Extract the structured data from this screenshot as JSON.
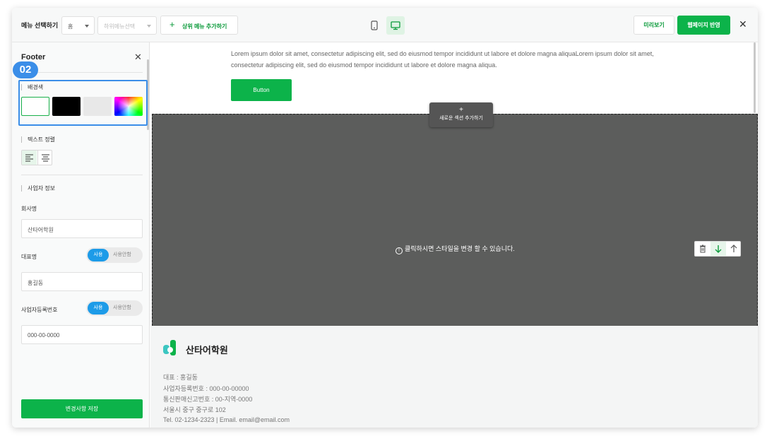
{
  "topbar": {
    "menu_select_label": "메뉴 선택하기",
    "menu_value": "홈",
    "submenu_placeholder": "하위메뉴선택",
    "add_top_menu": "상위 메뉴 추가하기",
    "preview": "미리보기",
    "apply": "웹페이지 반영"
  },
  "sidebar": {
    "title": "Footer",
    "step_badge": "02",
    "bg_color_label": "배경색",
    "bg_colors": [
      "#ffffff",
      "#000000",
      "#e8e8e8"
    ],
    "text_align_label": "텍스트 정렬",
    "business_info_label": "사업자 정보",
    "company_label": "회사명",
    "company_value": "산타어학원",
    "ceo_label": "대표명",
    "ceo_toggle_on": "사용",
    "ceo_toggle_off": "사용안함",
    "ceo_value": "홍길동",
    "reg_label": "사업자등록번호",
    "reg_toggle_on": "사용",
    "reg_toggle_off": "사용안함",
    "reg_value": "000-00-0000",
    "save": "변경사항 저장"
  },
  "canvas": {
    "lorem": "Lorem ipsum dolor sit amet, consectetur adipiscing elit, sed do eiusmod tempor incididunt ut labore et dolore magna aliquaLorem ipsum dolor sit amet, consectetur adipiscing elit, sed do eiusmod tempor incididunt ut labore et dolore magna aliqua.",
    "button": "Button",
    "add_section_plus": "+",
    "add_section": "새로운 섹션 추가하기",
    "gray_message": "클릭하시면 스타일을 변경 할 수 있습니다."
  },
  "footer": {
    "name": "산타어학원",
    "lines": [
      "대표 : 홍길동",
      "사업자등록번호 : 000-00-00000",
      "통신판매신고번호 : 00-지역-0000",
      "서울시 중구 중구로 102",
      "Tel. 02-1234-2323 | Email. email@email.com"
    ]
  },
  "colors": {
    "accent_green": "#0cb34a",
    "highlight_blue": "#3b8ee8",
    "section_gray": "#5c5d5c"
  },
  "icons": [
    "mobile-icon",
    "desktop-icon",
    "close-icon",
    "plus-icon",
    "align-left-icon",
    "align-center-icon",
    "info-icon",
    "trash-icon",
    "arrow-down-icon",
    "arrow-up-icon",
    "logo-icon"
  ]
}
